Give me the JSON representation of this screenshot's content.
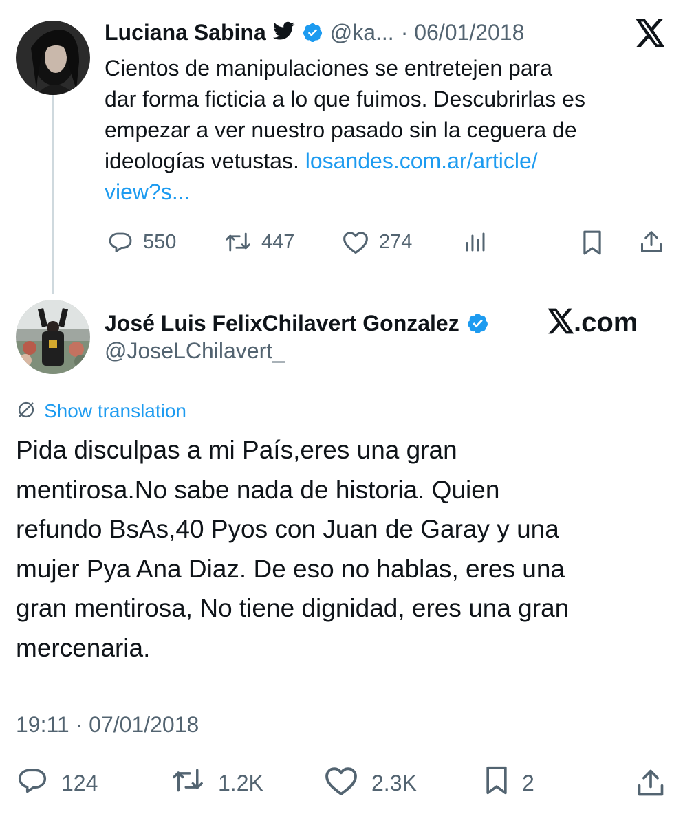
{
  "quoted": {
    "author_name": "Luciana Sabina",
    "handle": "@ka...",
    "date": "· 06/01/2018",
    "text_lines": [
      "Cientos de manipulaciones se entretejen para",
      "dar forma ficticia a lo que fuimos. Descubrirlas es",
      "empezar a ver nuestro pasado sin la ceguera de",
      "ideologías vetustas."
    ],
    "link_part1": "losandes.com.ar/article/",
    "link_part2": "view?s...",
    "stats": {
      "replies": "550",
      "retweets": "447",
      "likes": "274"
    }
  },
  "tweet": {
    "author_name": "José Luis FelixChilavert Gonzalez",
    "handle": "@JoseLChilavert_",
    "brand": "X.com",
    "show_translation": "Show translation",
    "text_lines": [
      "Pida disculpas a mi País,eres una gran",
      "mentirosa.No sabe nada de historia. Quien",
      "refundo BsAs,40 Pyos con Juan de Garay y una",
      "mujer Pya Ana Diaz. De eso no hablas, eres una",
      "gran mentirosa, No tiene dignidad, eres una gran",
      "mercenaria."
    ],
    "timestamp": "19:11 · 07/01/2018",
    "stats": {
      "replies": "124",
      "retweets": "1.2K",
      "likes": "2.3K",
      "bookmarks": "2"
    }
  },
  "colors": {
    "text": "#0f1419",
    "muted": "#536471",
    "link": "#1d9bf0",
    "verified": "#1d9bf0",
    "thread": "#cfd9de"
  }
}
